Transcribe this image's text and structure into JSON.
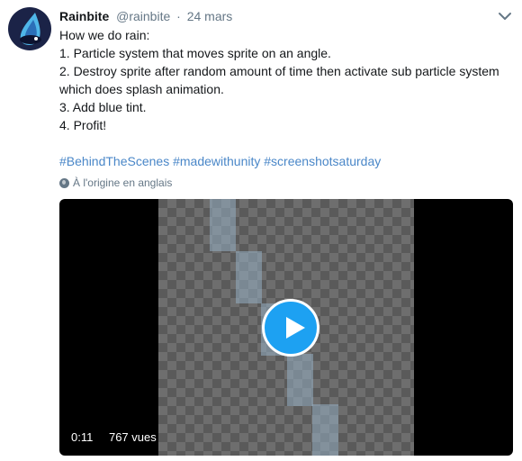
{
  "tweet": {
    "author_name": "Rainbite",
    "handle": "@rainbite",
    "separator": "·",
    "date": "24 mars",
    "lines": [
      "How we do rain:",
      "1. Particle system that moves sprite on an angle.",
      "2. Destroy sprite after random amount of time then activate sub particle system",
      "which does splash animation.",
      "3. Add blue tint.",
      "4. Profit!"
    ],
    "hashtags": [
      "#BehindTheScenes",
      "#madewithunity",
      "#screenshotsaturday"
    ],
    "translation_note": "À l'origine en anglais",
    "menu_icon": "chevron-down-icon",
    "colors": {
      "link": "#4a87c8",
      "play_button": "#1da1f2",
      "secondary_text": "#657786"
    }
  },
  "video": {
    "duration": "0:11",
    "views": "767 vues",
    "play_icon": "play-icon"
  }
}
